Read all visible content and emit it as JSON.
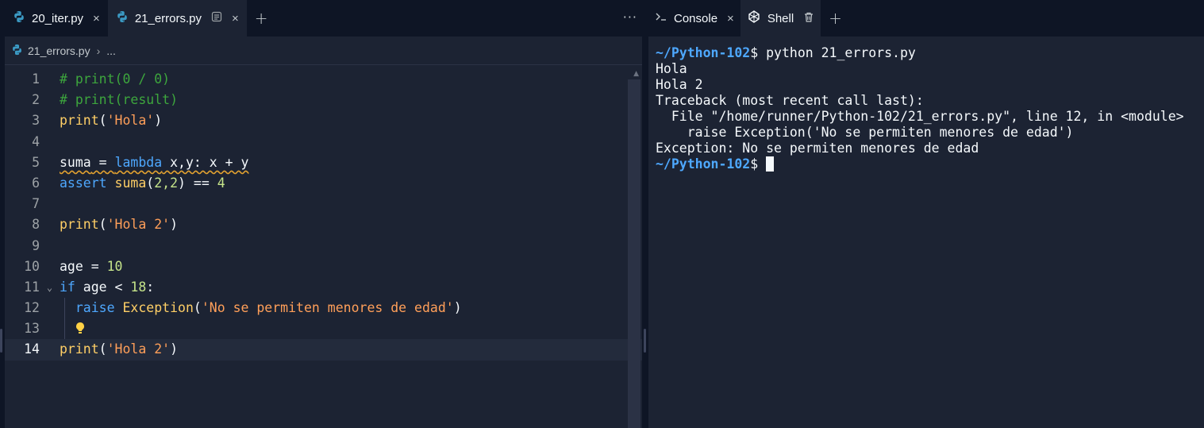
{
  "editor": {
    "tabs": [
      {
        "label": "20_iter.py",
        "close": "×"
      },
      {
        "label": "21_errors.py",
        "close": "×"
      }
    ],
    "add_tab": "+",
    "more": "···",
    "breadcrumb": {
      "file": "21_errors.py",
      "sep": "›",
      "rest": "..."
    },
    "current_line": 14,
    "lines": [
      {
        "n": "1"
      },
      {
        "n": "2"
      },
      {
        "n": "3"
      },
      {
        "n": "4"
      },
      {
        "n": "5"
      },
      {
        "n": "6"
      },
      {
        "n": "7"
      },
      {
        "n": "8"
      },
      {
        "n": "9"
      },
      {
        "n": "10"
      },
      {
        "n": "11"
      },
      {
        "n": "12"
      },
      {
        "n": "13"
      },
      {
        "n": "14"
      }
    ],
    "code": {
      "l1": "# print(0 / 0)",
      "l2": "# print(result)",
      "l3_fn": "print",
      "l3_str": "'Hola'",
      "l5_var": "suma",
      "l5_kw": "lambda",
      "l5_rest": " x,y: x + y",
      "l6_kw": "assert",
      "l6_fn": "suma",
      "l6_args": "2,2",
      "l6_num": "4",
      "l8_fn": "print",
      "l8_str": "'Hola 2'",
      "l10_var": "age",
      "l10_num": "10",
      "l11_kw": "if",
      "l11_var": " age < ",
      "l11_num": "18",
      "l12_kw": "raise",
      "l12_cls": "Exception",
      "l12_str": "'No se permiten menores de edad'",
      "l14_fn": "print",
      "l14_str": "'Hola 2'"
    }
  },
  "shell": {
    "tabs": [
      {
        "label": "Console",
        "close": "×"
      },
      {
        "label": "Shell",
        "close": "🗑"
      }
    ],
    "add_tab": "+",
    "prompt": "~/Python-102",
    "dollar": "$",
    "command": " python 21_errors.py",
    "output": [
      "Hola",
      "Hola 2",
      "Traceback (most recent call last):",
      "  File \"/home/runner/Python-102/21_errors.py\", line 12, in <module>",
      "    raise Exception('No se permiten menores de edad')",
      "Exception: No se permiten menores de edad"
    ]
  },
  "colors": {
    "background": "#0e1525",
    "panel": "#1c2333",
    "comment": "#3da63d",
    "function": "#ffcf66",
    "string": "#ff9f59",
    "keyword": "#4ea8ff",
    "number": "#c5e48a"
  }
}
